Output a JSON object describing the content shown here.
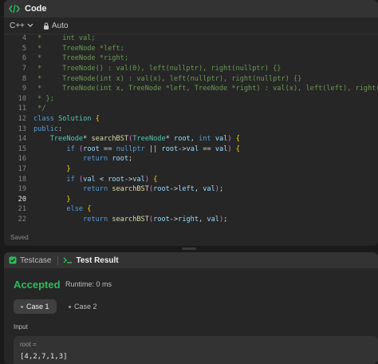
{
  "code_panel": {
    "title": "Code",
    "language": "C++",
    "auto_label": "Auto",
    "saved_label": "Saved",
    "active_line": "20",
    "lines": [
      {
        "num": "4",
        "text": " *     int val;"
      },
      {
        "num": "5",
        "text": " *     TreeNode *left;"
      },
      {
        "num": "6",
        "text": " *     TreeNode *right;"
      },
      {
        "num": "7",
        "text": " *     TreeNode() : val(0), left(nullptr), right(nullptr) {}"
      },
      {
        "num": "8",
        "text": " *     TreeNode(int x) : val(x), left(nullptr), right(nullptr) {}"
      },
      {
        "num": "9",
        "text": " *     TreeNode(int x, TreeNode *left, TreeNode *right) : val(x), left(left), right(ri"
      },
      {
        "num": "10",
        "text": " * };"
      },
      {
        "num": "11",
        "text": " */"
      },
      {
        "num": "12",
        "text": "class Solution {"
      },
      {
        "num": "13",
        "text": "public:"
      },
      {
        "num": "14",
        "text": "    TreeNode* searchBST(TreeNode* root, int val) {"
      },
      {
        "num": "15",
        "text": "        if (root == nullptr || root->val == val) {"
      },
      {
        "num": "16",
        "text": "            return root;"
      },
      {
        "num": "17",
        "text": "        }"
      },
      {
        "num": "18",
        "text": "        if (val < root->val) {"
      },
      {
        "num": "19",
        "text": "            return searchBST(root->left, val);"
      },
      {
        "num": "20",
        "text": "        }"
      },
      {
        "num": "21",
        "text": "        else {"
      },
      {
        "num": "22",
        "text": "            return searchBST(root->right, val);"
      }
    ]
  },
  "result_panel": {
    "tab_testcase": "Testcase",
    "tab_result": "Test Result",
    "status": "Accepted",
    "runtime": "Runtime: 0 ms",
    "cases": [
      "Case 1",
      "Case 2"
    ],
    "input_label": "Input",
    "input_key": "root =",
    "input_value": "[4,2,7,1,3]"
  },
  "colors": {
    "accepted": "#2cbb5d",
    "keyword": "#569cd6",
    "type": "#4ec9b0",
    "function": "#dcdcaa",
    "comment": "#6a9955"
  },
  "icons": [
    "code-icon",
    "chevron-down-icon",
    "lock-icon",
    "checkbox-icon",
    "terminal-icon"
  ]
}
